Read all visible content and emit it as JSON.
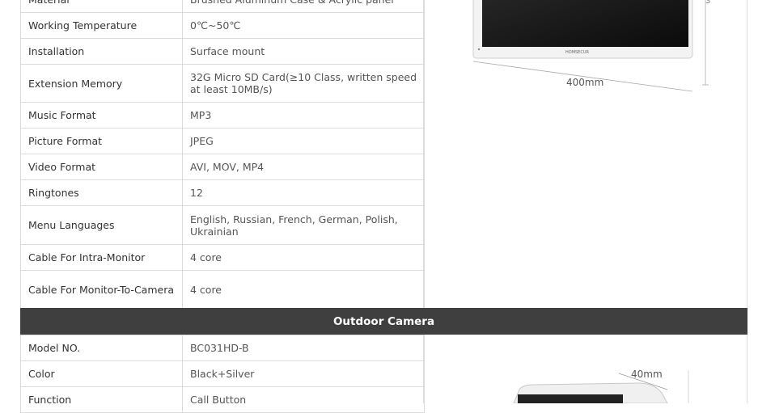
{
  "monitor_specs": [
    {
      "label": "Material",
      "value": "Brushed Aluminum Case & Acrylic panel"
    },
    {
      "label": "Working Temperature",
      "value": "0℃~50℃"
    },
    {
      "label": "Installation",
      "value": "Surface mount"
    },
    {
      "label": "Extension Memory",
      "value": "32G Micro SD Card(≥10 Class, written speed at least 10MB/s)"
    },
    {
      "label": "Music Format",
      "value": "MP3"
    },
    {
      "label": "Picture Format",
      "value": "JPEG"
    },
    {
      "label": "Video Format",
      "value": "AVI, MOV, MP4"
    },
    {
      "label": "Ringtones",
      "value": "12"
    },
    {
      "label": "Menu Languages",
      "value": "English, Russian, French, German, Polish, Ukrainian"
    },
    {
      "label": "Cable For Intra-Monitor",
      "value": "4 core"
    },
    {
      "label": "Cable For Monitor-To-Camera",
      "value": "4 core"
    }
  ],
  "section": {
    "title": "Outdoor Camera"
  },
  "camera_specs": [
    {
      "label": "Model NO.",
      "value": "BC031HD-B"
    },
    {
      "label": "Color",
      "value": "Black+Silver"
    },
    {
      "label": "Function",
      "value": "Call Button"
    }
  ],
  "monitor_image": {
    "brand": "HOMSECUR",
    "width_label": "400mm"
  },
  "camera_image": {
    "depth_label": "40mm"
  }
}
